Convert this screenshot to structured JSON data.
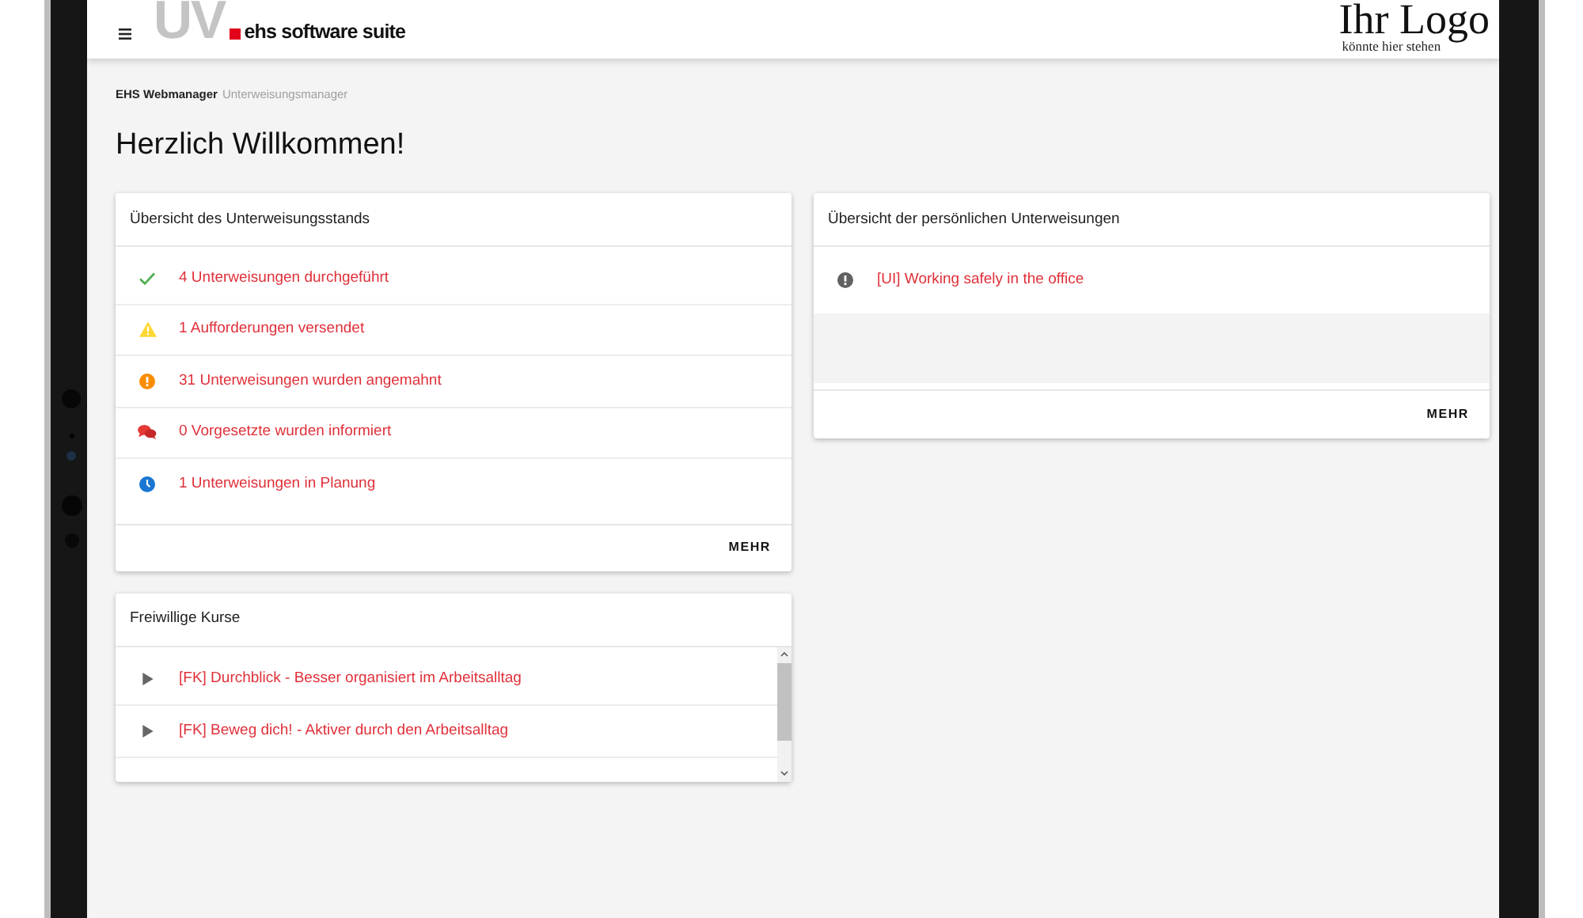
{
  "header": {
    "brand_mark": "UV",
    "product_name": "ehs software suite",
    "customer_logo": {
      "title": "Ihr Logo",
      "subtitle": "könnte hier stehen"
    }
  },
  "breadcrumb": [
    {
      "label": "EHS Webmanager",
      "current": false
    },
    {
      "label": "Unterweisungsmanager",
      "current": true
    }
  ],
  "heading": "Herzlich Willkommen!",
  "status_overview": {
    "title": "Übersicht des Unterweisungsstands",
    "items": [
      {
        "kind": "completed",
        "label": "4 Unterweisungen durchgeführt"
      },
      {
        "kind": "requested",
        "label": "1 Aufforderungen versendet"
      },
      {
        "kind": "reminded",
        "label": "31 Unterweisungen wurden angemahnt"
      },
      {
        "kind": "supervisor",
        "label": "0 Vorgesetzte wurden informiert"
      },
      {
        "kind": "planned",
        "label": "1 Unterweisungen in Planung"
      }
    ],
    "button": "MEHR"
  },
  "personal_overview": {
    "title": "Übersicht der persönlichen Unterweisungen",
    "items": [
      {
        "kind": "pending",
        "label": "[UI] Working safely in the office"
      }
    ],
    "button": "MEHR"
  },
  "voluntary_courses": {
    "title": "Freiwillige Kurse",
    "items": [
      {
        "label": "[FK] Durchblick - Besser organisiert im Arbeitsalltag"
      },
      {
        "label": "[FK] Beweg dich! - Aktiver durch den Arbeitsalltag"
      }
    ]
  }
}
